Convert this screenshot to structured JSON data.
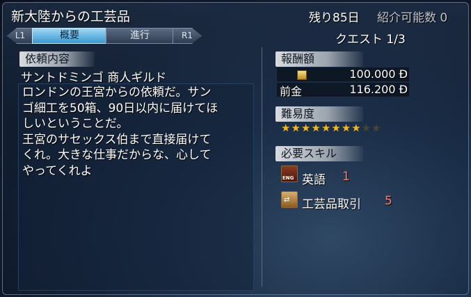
{
  "header": {
    "title": "新大陸からの工芸品",
    "days_left": "残り85日",
    "introducible": "紹介可能数 0",
    "quest_progress": "クエスト 1/3"
  },
  "tabs": {
    "l1": "L1",
    "summary": "概要",
    "progress": "進行",
    "r1": "R1",
    "active": "summary"
  },
  "request": {
    "section_label": "依頼内容",
    "requester": "サントドミンゴ 商人ギルド",
    "description_lines": [
      "ロンドンの王宮からの依頼だ。サン",
      "ゴ細工を50箱、90日以内に届けてほ",
      "しいということだ。",
      "王宮のサセックス伯まで直接届けて",
      "くれ。大きな仕事だからな、心して",
      "やってくれよ"
    ]
  },
  "reward": {
    "section_label": "報酬額",
    "reward_amount": "100.000 Ð",
    "advance_label": "前金",
    "advance_amount": "116.200 Ð"
  },
  "difficulty": {
    "section_label": "難易度",
    "stars_filled": 8,
    "stars_total": 10
  },
  "skills": {
    "section_label": "必要スキル",
    "items": [
      {
        "name": "英語",
        "level": "1",
        "icon": "english-book-icon"
      },
      {
        "name": "工芸品取引",
        "level": "5",
        "icon": "craft-trade-icon"
      }
    ]
  },
  "colors": {
    "accent_tab": "#3a98cf",
    "skill_level": "#ff7e6e",
    "star": "#f2b820"
  }
}
